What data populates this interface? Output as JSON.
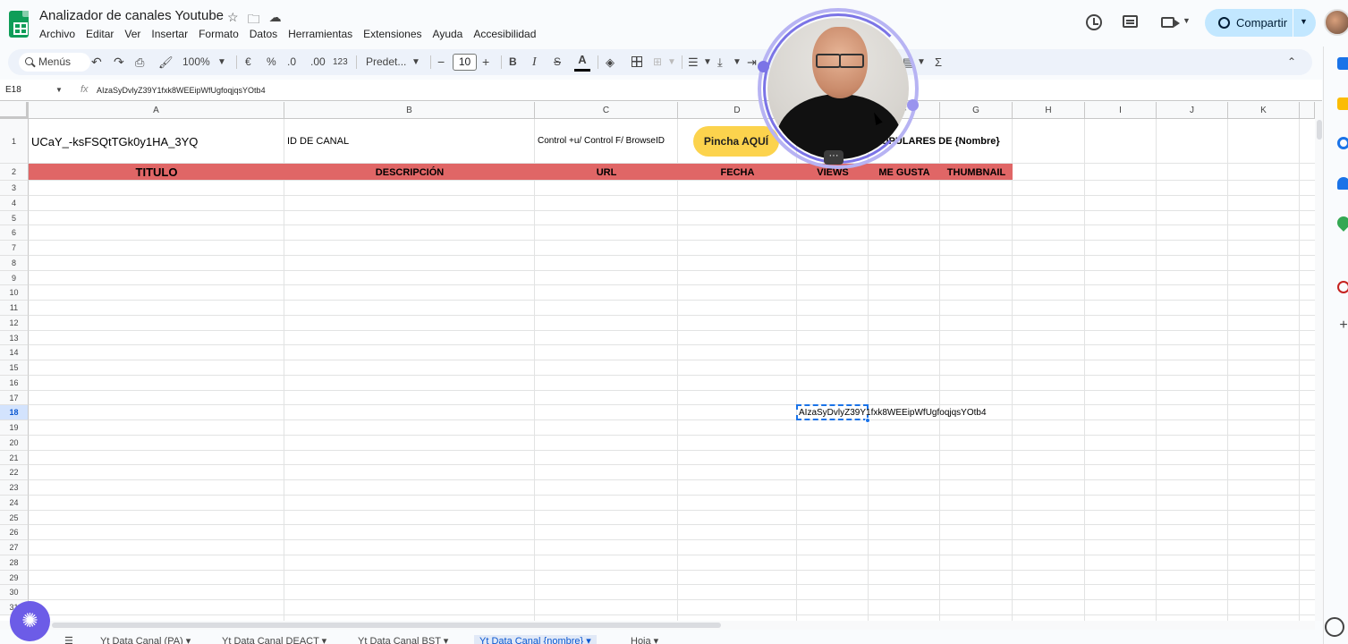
{
  "title_bar": {
    "doc_title": "Analizador de canales Youtube",
    "share_label": "Compartir"
  },
  "menu": [
    "Archivo",
    "Editar",
    "Ver",
    "Insertar",
    "Formato",
    "Datos",
    "Herramientas",
    "Extensiones",
    "Ayuda",
    "Accesibilidad"
  ],
  "toolbar": {
    "search_label": "Menús",
    "zoom": "100%",
    "currency": "€",
    "percent": "%",
    "dec_decrease": ".0",
    "dec_increase": ".00",
    "format_123": "123",
    "font": "Predet...",
    "font_size": "10",
    "bold": "B",
    "italic": "I",
    "strike": "S",
    "text_color": "A",
    "sum": "Σ"
  },
  "formula_bar": {
    "cell_ref": "E18",
    "fx": "fx",
    "content": "AIzaSyDvlyZ39Y1fxk8WEEipWfUgfoqjqsYOtb4"
  },
  "columns": [
    "A",
    "B",
    "C",
    "D",
    "E",
    "F",
    "G",
    "H",
    "I",
    "J",
    "K"
  ],
  "rows": [
    "1",
    "2",
    "3",
    "4",
    "5",
    "6",
    "7",
    "8",
    "9",
    "10",
    "11",
    "12",
    "13",
    "14",
    "15",
    "16",
    "17",
    "18",
    "19",
    "20",
    "21",
    "22",
    "23",
    "24",
    "25",
    "26",
    "27",
    "28",
    "29",
    "30",
    "31"
  ],
  "cells": {
    "A1": "UCaY_-ksFSQtTGk0y1HA_3YQ",
    "B1": "ID DE CANAL",
    "C1": "Control +u/ Control F/ BrowseID",
    "D1_button": "Pincha AQUÍ",
    "F1": "OPULARES DE {Nombre}",
    "E18": "AIzaSyDvlyZ39Y1fxk8WEEipWfUgfoqjqsYOtb4"
  },
  "header_row": {
    "titulo": "TITULO",
    "descripcion": "DESCRIPCIÓN",
    "url": "URL",
    "fecha": "FECHA",
    "views": "VIEWS",
    "me_gusta": "ME GUSTA",
    "thumbnail": "THUMBNAIL"
  },
  "sheet_tabs": [
    "Yt Data Canal (PA) ▾",
    "Yt Data Canal DEACT ▾",
    "Yt Data Canal BST ▾",
    "Yt Data Canal {nombre} ▾",
    "Hoja ▾"
  ],
  "colors": {
    "header_row_bg": "#e06666",
    "pincha_button": "#fcd34d",
    "share_button": "#c2e7ff",
    "selection": "#1a73e8",
    "ring": "#7b74e6"
  }
}
